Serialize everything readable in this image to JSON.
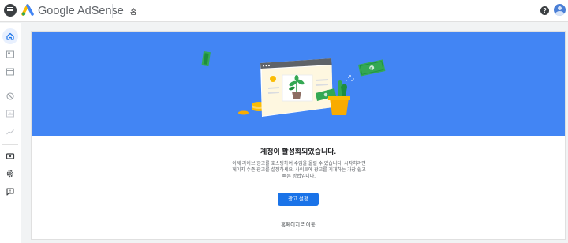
{
  "header": {
    "brand": "Google AdSense",
    "page_title": "홈",
    "help_glyph": "?"
  },
  "sidebar": {
    "items": [
      {
        "icon": "home-icon",
        "active": true
      },
      {
        "icon": "ads-icon"
      },
      {
        "icon": "sites-icon"
      },
      {
        "icon": "blocking-icon"
      },
      {
        "icon": "reports-icon"
      },
      {
        "icon": "trending-icon"
      },
      {
        "icon": "payments-icon"
      },
      {
        "icon": "settings-icon"
      },
      {
        "icon": "feedback-icon"
      }
    ]
  },
  "main": {
    "title": "계정이 활성화되었습니다.",
    "description": "이제 라이브 광고를 호스팅하여 수입을 올릴 수 있습니다. 시작하려면 페이지 수준 광고를 설정하세요. 사이트에 광고를 게재하는 가장 쉽고 빠른 방법입니다.",
    "primary_button": "광고 설정",
    "secondary_link": "홈페이지로 이동"
  },
  "colors": {
    "accent": "#1a73e8",
    "hero": "#4285f4",
    "money": "#34a853",
    "pot": "#fbbc04"
  }
}
